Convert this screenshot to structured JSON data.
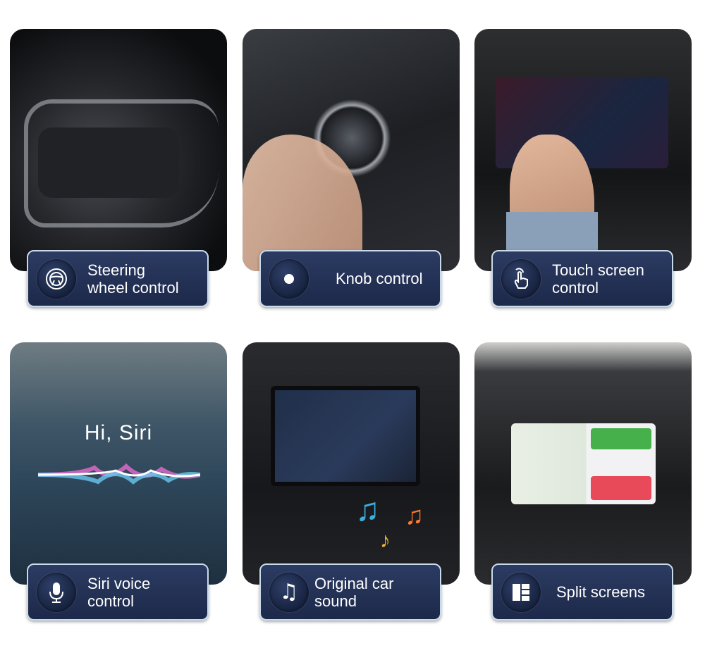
{
  "features": [
    {
      "label_line1": "Steering",
      "label_line2": "wheel control",
      "icon": "steering-wheel-icon"
    },
    {
      "label_line1": "Knob control",
      "icon": "knob-dot-icon"
    },
    {
      "label_line1": "Touch screen",
      "label_line2": "control",
      "icon": "touch-hand-icon"
    },
    {
      "label_line1": "Siri voice",
      "label_line2": "control",
      "icon": "microphone-icon",
      "photo_text": "Hi, Siri"
    },
    {
      "label_line1": "Original car sound",
      "icon": "music-note-icon"
    },
    {
      "label_line1": "Split screens",
      "icon": "split-screen-icon"
    }
  ],
  "colors": {
    "label_bg": "#1f2d50",
    "label_border": "#c9daec",
    "text": "#ffffff"
  }
}
